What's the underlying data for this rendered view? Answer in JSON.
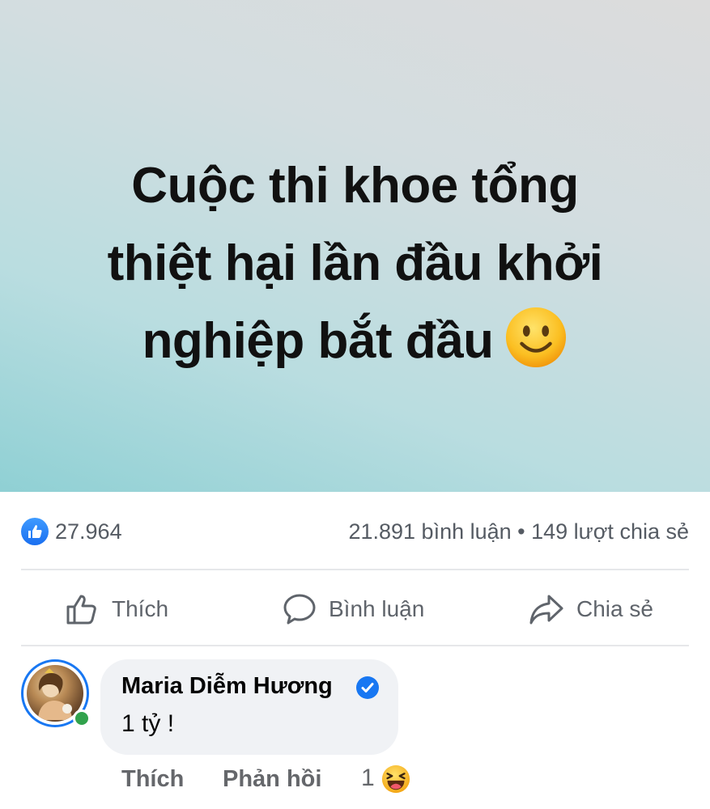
{
  "post": {
    "text_lines": [
      "Cuộc thi khoe tổng",
      "thiệt hại lần đầu khởi",
      "nghiệp bắt đầu"
    ],
    "emoji": "smiling-face"
  },
  "stats": {
    "likes": "27.964",
    "comments_shares": "21.891 bình luận • 149 lượt chia sẻ"
  },
  "actions": {
    "like": "Thích",
    "comment": "Bình luận",
    "share": "Chia sẻ"
  },
  "comment": {
    "author": "Maria Diễm Hương",
    "verified": true,
    "text": "1 tỷ !",
    "like_label": "Thích",
    "reply_label": "Phản hồi",
    "reaction_count": "1",
    "reaction": "haha"
  },
  "colors": {
    "accent": "#1877f2",
    "online": "#31a24c",
    "muted_text": "#65676b"
  }
}
